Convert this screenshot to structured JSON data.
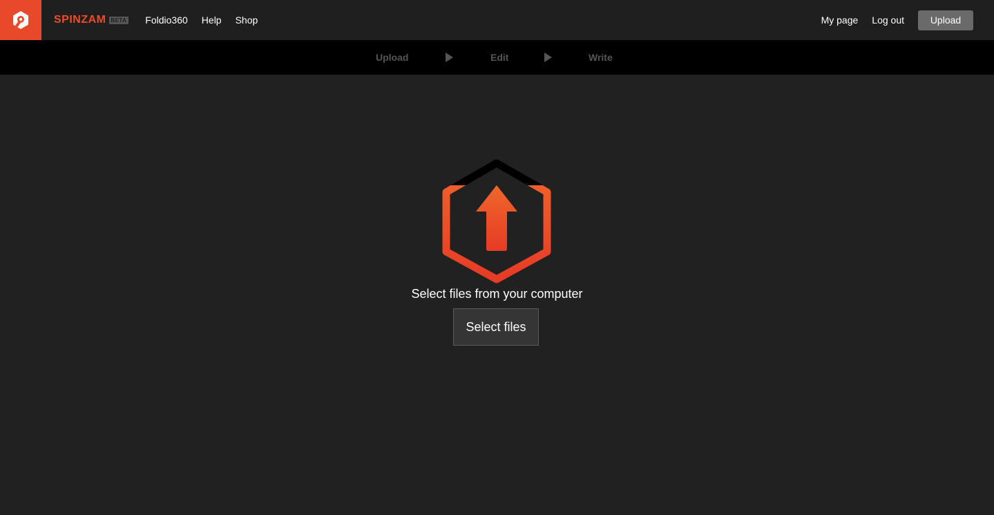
{
  "header": {
    "brand": "SPINZAM",
    "badge": "BETA",
    "nav": [
      {
        "label": "Foldio360"
      },
      {
        "label": "Help"
      },
      {
        "label": "Shop"
      }
    ],
    "my_page": "My page",
    "log_out": "Log out",
    "upload_button": "Upload"
  },
  "steps": [
    {
      "label": "Upload"
    },
    {
      "label": "Edit"
    },
    {
      "label": "Write"
    }
  ],
  "main": {
    "prompt": "Select files from your computer",
    "select_button": "Select files"
  },
  "colors": {
    "accent": "#e8492a",
    "background": "#212121",
    "stepbar": "#000000",
    "step_inactive": "#555555"
  },
  "icons": [
    "spinzam-logo-icon",
    "upload-arrow-icon",
    "play-arrow-icon"
  ]
}
